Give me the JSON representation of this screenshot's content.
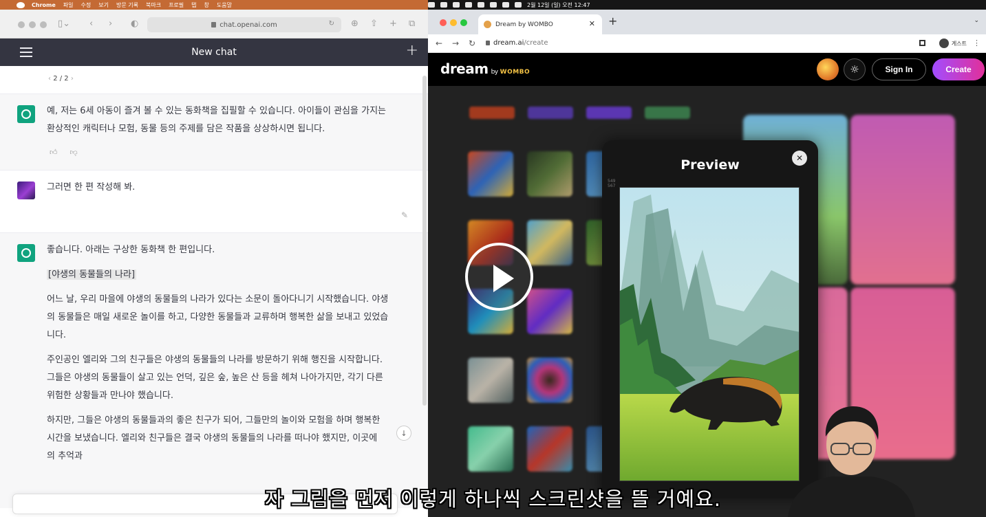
{
  "menubar": {
    "app": "Chrome",
    "items": [
      "파일",
      "수정",
      "보기",
      "방문 기록",
      "북마크",
      "프로필",
      "탭",
      "창",
      "도움말"
    ],
    "clock": "2월 12일 (일) 오전 12:47"
  },
  "safari": {
    "url": "chat.openai.com"
  },
  "chatgpt": {
    "header_title": "New chat",
    "pager": "2 / 2",
    "msg1": {
      "l1": "예, 저는 6세 아동이 즐겨 볼 수 있는 동화책을 집필할 수 있습니다. 아이들이 관심을 가지는",
      "l2": "환상적인 캐릭터나 모험, 동물 등의 주제를 담은 작품을 상상하시면 됩니다."
    },
    "user_msg": "그러면 한 편 작성해 봐.",
    "msg2": {
      "intro": "좋습니다. 아래는 구상한 동화책 한 편입니다.",
      "story_title": "[야생의 동물들의 나라]",
      "p1a": "어느 날, 우리 마을에 야생의 동물들의 나라가 있다는 소문이 돌아다니기 시작했습니다. 야생",
      "p1b": "의 동물들은 매일 새로운 놀이를 하고, 다양한 동물들과 교류하며 행복한 삶을 보내고 있었습",
      "p1c": "니다.",
      "p2a": "주인공인 엘리와 그의 친구들은 야생의 동물들의 나라를 방문하기 위해 행진을 시작합니다.",
      "p2b": "그들은 야생의 동물들이 살고 있는 언덕, 깊은 숲, 높은 산 등을 헤쳐 나아가지만, 각기 다른",
      "p2c": "위험한 상황들과 만나야 했습니다.",
      "p3a": "하지만, 그들은 야생의 동물들과의 좋은 친구가 되어, 그들만의 놀이와 모험을 하며 행복한",
      "p3b": "시간을 보냈습니다. 엘리와 친구들은 결국 야생의 동물들의 나라를 떠나야 했지만, 이곳에",
      "p3c": "의 추억과"
    }
  },
  "chrome": {
    "tab_title": "Dream by WOMBO",
    "url_host": "dream.ai",
    "url_path": "/create",
    "profile": "게스트"
  },
  "dream": {
    "logo": "dream",
    "by": "by",
    "wombo": "WOMBO",
    "signin": "Sign In",
    "create": "Create",
    "preview_title": "Preview",
    "dims": "549\n567"
  },
  "subtitle": "자 그림을 먼저 이렇게 하나씩 스크린샷을 뜰 거예요.",
  "colors": {
    "menubar": "#c46a34",
    "gpt_header": "#343541",
    "gpt_green": "#10a37f",
    "create_gradient_start": "#a24dff",
    "create_gradient_end": "#e1309a"
  }
}
